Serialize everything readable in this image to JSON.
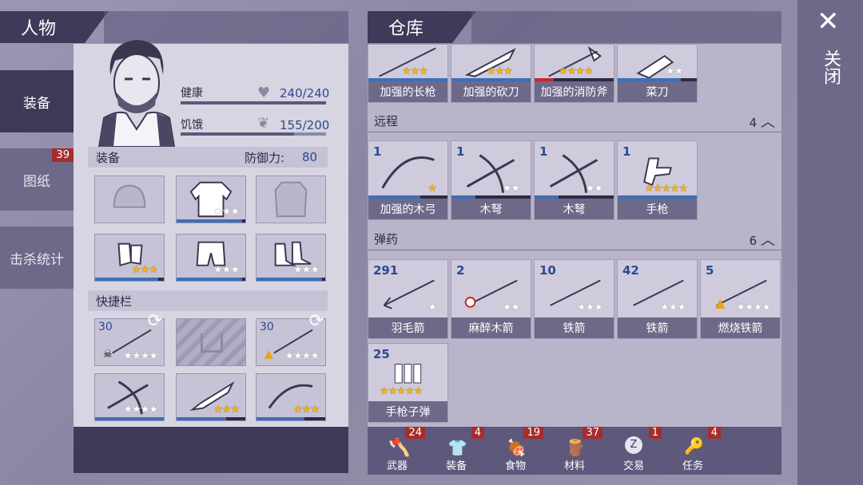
{
  "character_panel": {
    "title": "人物"
  },
  "left_tabs": [
    {
      "label": "装备",
      "active": true
    },
    {
      "label": "图纸",
      "badge": "39"
    },
    {
      "label": "击杀统计"
    }
  ],
  "stats": {
    "health_label": "健康",
    "health_value": "240/240",
    "hunger_label": "饥饿",
    "hunger_value": "155/200"
  },
  "equipment": {
    "label": "装备",
    "defense_label": "防御力:",
    "defense_value": "80"
  },
  "quickbar": {
    "label": "快捷栏",
    "slot1_count": "30",
    "slot3_count": "30"
  },
  "warehouse": {
    "title": "仓库"
  },
  "melee_items": [
    {
      "label": "加强的长枪",
      "stars": 3,
      "gold": 3
    },
    {
      "label": "加强的砍刀",
      "stars": 3,
      "gold": 3
    },
    {
      "label": "加强的消防斧",
      "stars": 4,
      "gold": 4
    },
    {
      "label": "菜刀",
      "stars": 2,
      "gold": 0
    }
  ],
  "ranged": {
    "label": "远程",
    "count": "4",
    "items": [
      {
        "label": "加强的木弓",
        "count": "1",
        "stars": 1,
        "gold": 1
      },
      {
        "label": "木弩",
        "count": "1",
        "stars": 2,
        "gold": 0
      },
      {
        "label": "木弩",
        "count": "1",
        "stars": 2,
        "gold": 0
      },
      {
        "label": "手枪",
        "count": "1",
        "stars": 5,
        "gold": 5
      }
    ]
  },
  "ammo": {
    "label": "弹药",
    "count": "6",
    "items": [
      {
        "label": "羽毛箭",
        "count": "291",
        "stars": 1,
        "gold": 0
      },
      {
        "label": "麻醉木箭",
        "count": "2",
        "stars": 2,
        "gold": 0
      },
      {
        "label": "铁箭",
        "count": "10",
        "stars": 3,
        "gold": 0
      },
      {
        "label": "铁箭",
        "count": "42",
        "stars": 3,
        "gold": 0
      },
      {
        "label": "燃烧铁箭",
        "count": "5",
        "stars": 4,
        "gold": 0
      },
      {
        "label": "手枪子弹",
        "count": "25",
        "stars": 5,
        "gold": 5
      }
    ]
  },
  "bottom_tabs": [
    {
      "label": "武器",
      "badge": "24"
    },
    {
      "label": "装备",
      "badge": "4"
    },
    {
      "label": "食物",
      "badge": "19"
    },
    {
      "label": "材料",
      "badge": "37"
    },
    {
      "label": "交易",
      "badge": "1"
    },
    {
      "label": "任务",
      "badge": "4"
    }
  ],
  "close_label": "关闭",
  "colors": {
    "accent": "#3d6fb6",
    "star_gold": "#f1b21f",
    "badge_red": "#a62d2d",
    "header_dark": "#3f3a5a"
  }
}
